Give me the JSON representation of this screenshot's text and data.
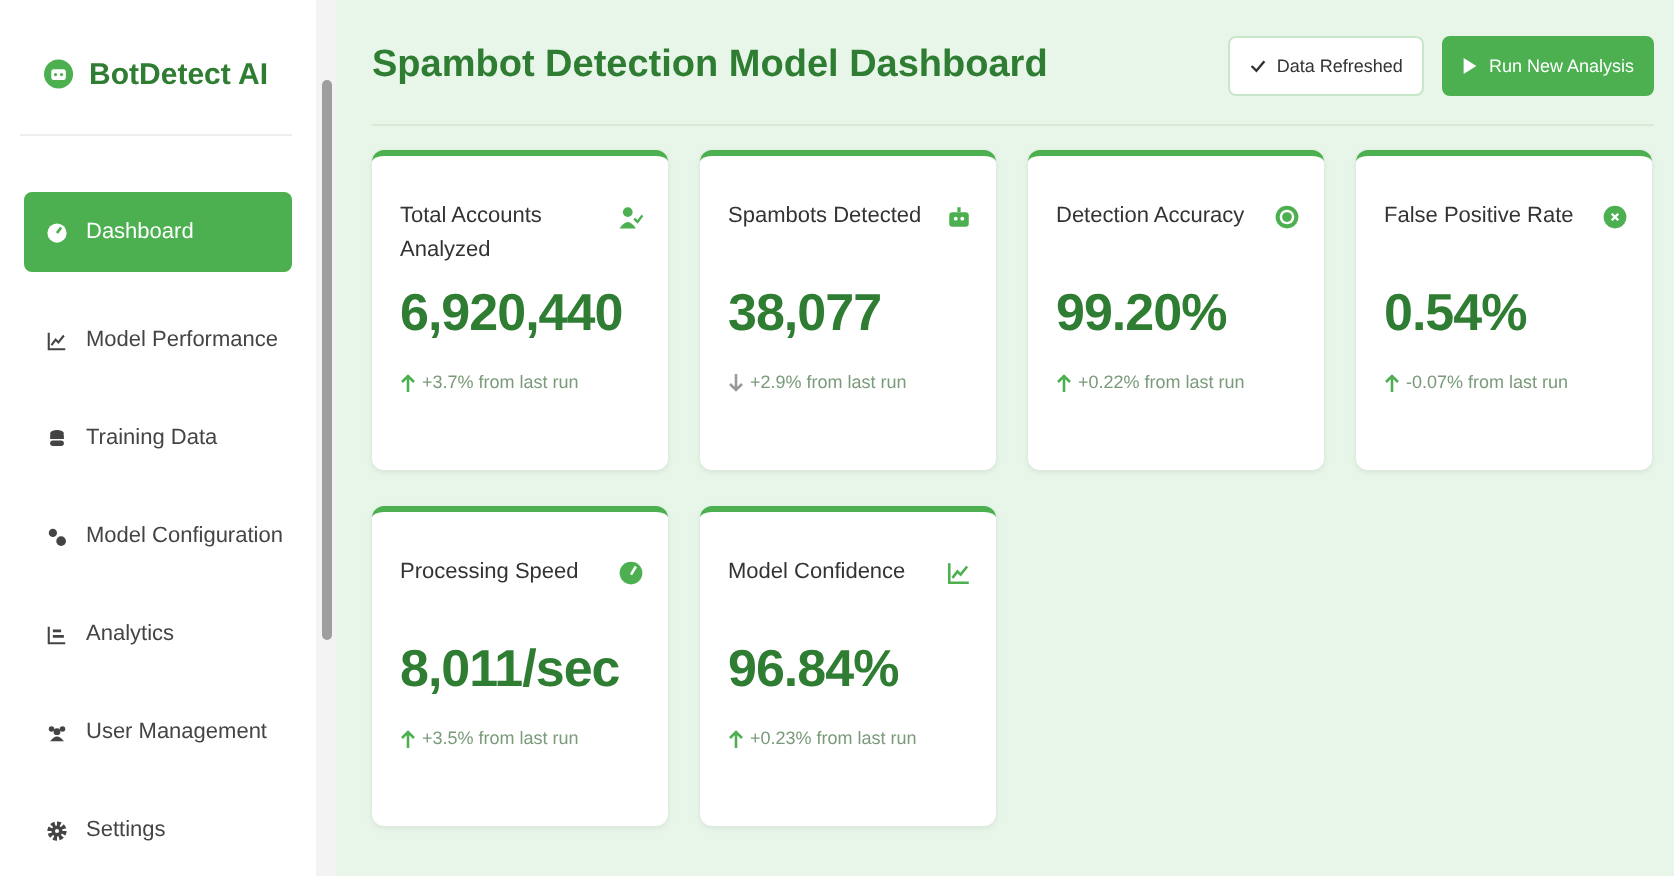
{
  "brand": {
    "name": "BotDetect AI"
  },
  "sidebar": {
    "items": [
      {
        "label": "Dashboard",
        "selected": true
      },
      {
        "label": "Model Performance",
        "selected": false
      },
      {
        "label": "Training Data",
        "selected": false
      },
      {
        "label": "Model Configuration",
        "selected": false
      },
      {
        "label": "Analytics",
        "selected": false
      },
      {
        "label": "User Management",
        "selected": false
      },
      {
        "label": "Settings",
        "selected": false
      }
    ]
  },
  "header": {
    "title": "Spambot Detection Model Dashboard",
    "status_button": "Data Refreshed",
    "action_button": "Run New Analysis"
  },
  "cards": [
    {
      "title": "Total Accounts Analyzed",
      "value": "6,920,440",
      "change": "+3.7% from last run",
      "kind": "up"
    },
    {
      "title": "Spambots Detected",
      "value": "38,077",
      "change": "+2.9% from last run",
      "kind": "down"
    },
    {
      "title": "Detection Accuracy",
      "value": "99.20%",
      "change": "+0.22% from last run",
      "kind": "up"
    },
    {
      "title": "False Positive Rate",
      "value": "0.54%",
      "change": "-0.07% from last run",
      "kind": "up"
    },
    {
      "title": "Processing Speed",
      "value": "8,011/sec",
      "change": "+3.5% from last run",
      "kind": "up"
    },
    {
      "title": "Model Confidence",
      "value": "96.84%",
      "change": "+0.23% from last run",
      "kind": "up"
    }
  ]
}
